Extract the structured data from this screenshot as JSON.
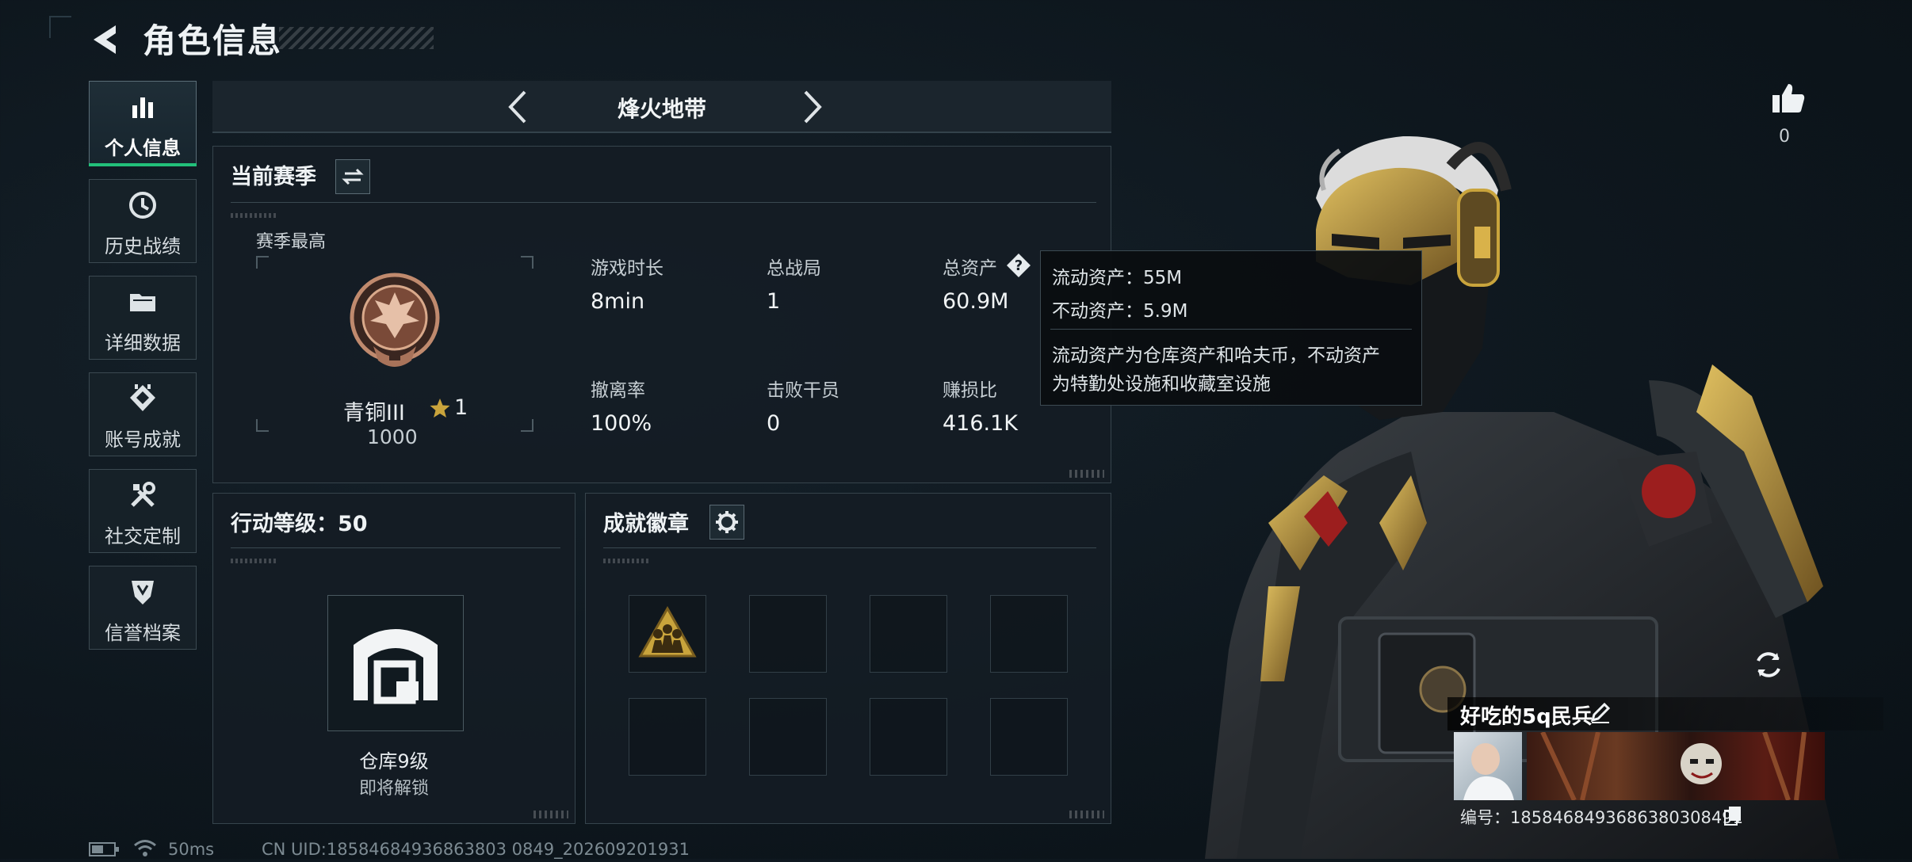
{
  "header": {
    "title": "角色信息"
  },
  "sidebar": {
    "items": [
      {
        "label": "个人信息",
        "icon": "bar-chart-icon",
        "active": true
      },
      {
        "label": "历史战绩",
        "icon": "history-clock-icon"
      },
      {
        "label": "详细数据",
        "icon": "folder-icon"
      },
      {
        "label": "账号成就",
        "icon": "achievement-icon"
      },
      {
        "label": "社交定制",
        "icon": "tools-icon"
      },
      {
        "label": "信誉档案",
        "icon": "shield-icon"
      }
    ]
  },
  "mode": {
    "title": "烽火地带"
  },
  "season": {
    "title": "当前赛季",
    "best_label": "赛季最高",
    "rank_name": "青铜III",
    "rank_stars": "1",
    "rank_score": "1000",
    "stats": [
      {
        "label": "游戏时长",
        "value": "8min"
      },
      {
        "label": "总战局",
        "value": "1"
      },
      {
        "label": "总资产",
        "value": "60.9M"
      },
      {
        "label": "撤离率",
        "value": "100%"
      },
      {
        "label": "击败干员",
        "value": "0"
      },
      {
        "label": "赚损比",
        "value": "416.1K"
      }
    ]
  },
  "tooltip": {
    "liquid": "流动资产：55M",
    "fixed": "不动资产：5.9M",
    "desc_line1": "流动资产为仓库资产和哈夫币，不动资产",
    "desc_line2": "为特勤处设施和收藏室设施"
  },
  "action_level": {
    "title": "行动等级：50",
    "unlock_name": "仓库9级",
    "unlock_status": "即将解锁"
  },
  "achievements": {
    "title": "成就徽章",
    "filled_slots": 1,
    "total_slots": 8
  },
  "profile": {
    "likes": "0",
    "name": "好吃的5q民兵",
    "id_text": "编号：1858468493686380308491"
  },
  "status": {
    "ping": "50ms",
    "uid": "CN UID:18584684936863803 0849_202609201931"
  },
  "colors": {
    "accent_green": "#22c07a",
    "rank_bronze": "#a8735a",
    "gold": "#c9a43c"
  }
}
